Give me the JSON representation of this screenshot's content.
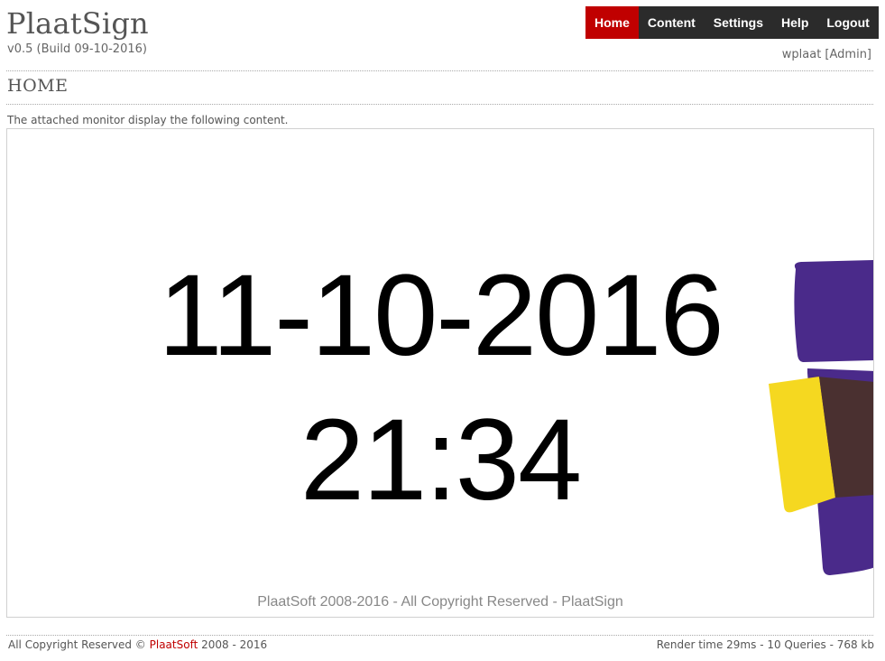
{
  "header": {
    "app_title": "PlaatSign",
    "version": "v0.5 (Build 09-10-2016)",
    "user": "wplaat [Admin]"
  },
  "menu": {
    "items": [
      {
        "label": "Home",
        "active": true
      },
      {
        "label": "Content",
        "active": false
      },
      {
        "label": "Settings",
        "active": false
      },
      {
        "label": "Help",
        "active": false
      },
      {
        "label": "Logout",
        "active": false
      }
    ]
  },
  "main": {
    "page_title": "HOME",
    "intro_text": "The attached monitor display the following content."
  },
  "display": {
    "date": "11-10-2016",
    "time": "21:34",
    "footer": "PlaatSoft 2008-2016 - All Copyright Reserved - PlaatSign"
  },
  "footer": {
    "copyright_prefix": "All Copyright Reserved © ",
    "brand": "PlaatSoft",
    "years": " 2008 - 2016",
    "stats": "Render time 29ms - 10 Queries - 768 kb"
  },
  "colors": {
    "accent": "#c00000",
    "menu_bg": "#2b2b2b",
    "decor_purple": "#4a2a8a",
    "decor_yellow": "#f5d820",
    "decor_brown": "#4a3030"
  }
}
